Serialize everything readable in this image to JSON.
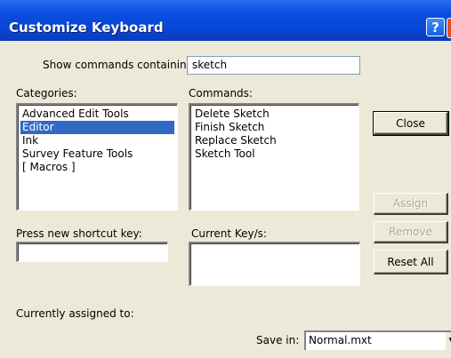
{
  "window": {
    "title": "Customize Keyboard",
    "help_glyph": "?"
  },
  "search": {
    "label": "Show commands containing:",
    "value": "sketch"
  },
  "categories": {
    "label": "Categories:",
    "items": [
      "Advanced Edit Tools",
      "Editor",
      "Ink",
      "Survey Feature Tools",
      "[ Macros ]"
    ],
    "selected": "Editor"
  },
  "commands": {
    "label": "Commands:",
    "items": [
      "Delete Sketch",
      "Finish Sketch",
      "Replace Sketch",
      "Sketch Tool"
    ]
  },
  "shortcut": {
    "label": "Press new shortcut key:",
    "value": ""
  },
  "current_keys": {
    "label": "Current Key/s:"
  },
  "assigned": {
    "label": "Currently assigned to:"
  },
  "buttons": {
    "close": "Close",
    "assign": "Assign",
    "remove": "Remove",
    "reset_all": "Reset All"
  },
  "save_in": {
    "label": "Save in:",
    "value": "Normal.mxt"
  },
  "icons": {
    "help": "help-icon",
    "dropdown": "chevron-down-icon"
  }
}
